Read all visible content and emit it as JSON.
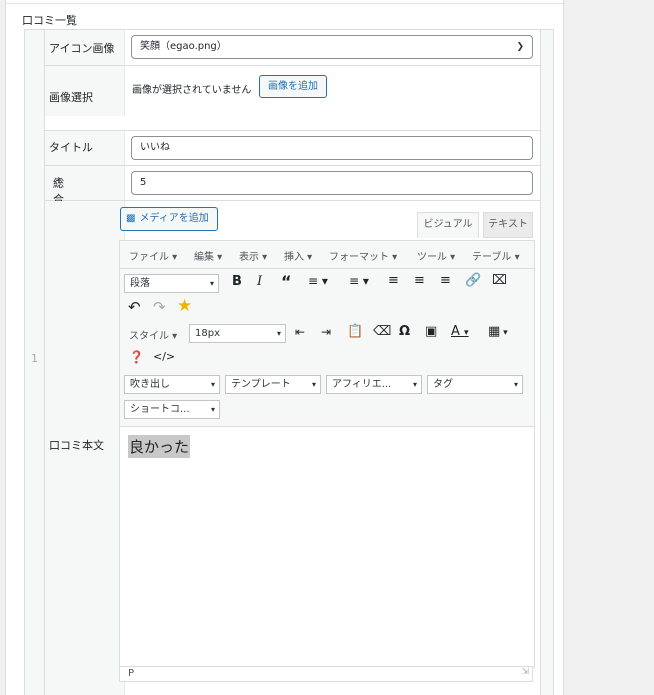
{
  "section": {
    "title": "口コミ一覧"
  },
  "row": {
    "number": "1"
  },
  "fields": {
    "icon": {
      "label": "アイコン画像",
      "value": "笑顔（egao.png）"
    },
    "image": {
      "label": "画像選択",
      "status": "画像が選択されていません",
      "button": "画像を追加"
    },
    "title": {
      "label": "タイトル",
      "value": "いいね"
    },
    "score": {
      "label": "総合得点",
      "required": "*",
      "value": "5"
    },
    "body": {
      "label": "口コミ本文"
    }
  },
  "editor": {
    "media_button": "メディアを追加",
    "tabs": {
      "visual": "ビジュアル",
      "text": "テキスト"
    },
    "menu": [
      "ファイル",
      "編集",
      "表示",
      "挿入",
      "フォーマット",
      "ツール",
      "テーブル"
    ],
    "format_select": "段落",
    "style_select": "スタイル",
    "fontsize_select": "18px",
    "dropdowns": [
      "吹き出し",
      "テンプレート",
      "アフィリエ...",
      "タグ",
      "ショートコ..."
    ],
    "content": "良かった",
    "status_path": "P"
  }
}
